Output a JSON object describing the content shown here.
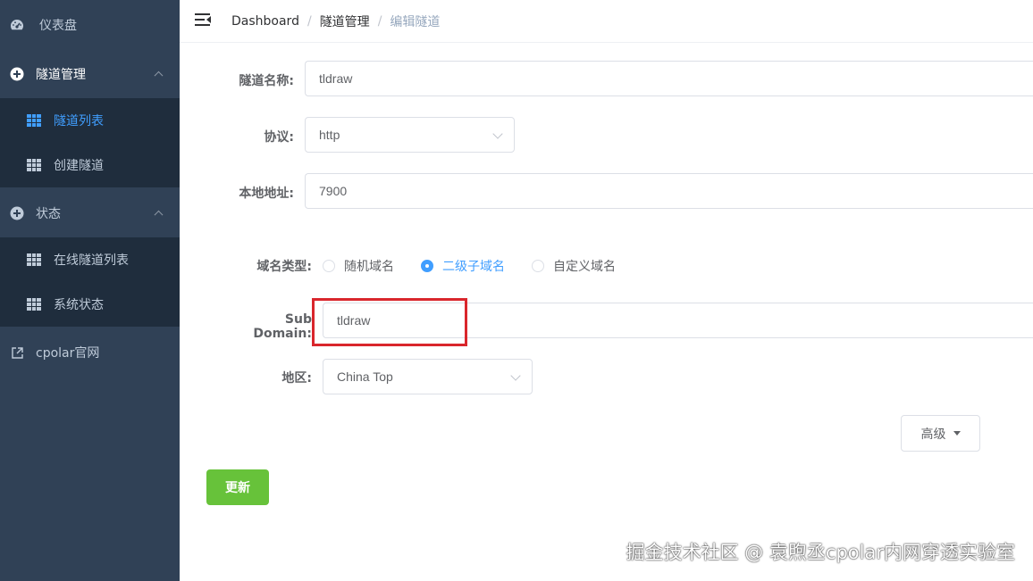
{
  "sidebar": {
    "dashboard": "仪表盘",
    "tunnel_manage": "隧道管理",
    "tunnel_list": "隧道列表",
    "create_tunnel": "创建隧道",
    "status": "状态",
    "online_tunnels": "在线隧道列表",
    "system_status": "系统状态",
    "official_site": "cpolar官网"
  },
  "breadcrumb": {
    "root": "Dashboard",
    "parent": "隧道管理",
    "current": "编辑隧道",
    "separator": "/"
  },
  "form": {
    "name_label": "隧道名称:",
    "name_value": "tldraw",
    "protocol_label": "协议:",
    "protocol_value": "http",
    "local_addr_label": "本地地址:",
    "local_addr_value": "7900",
    "domain_type_label": "域名类型:",
    "domain_types": [
      "随机域名",
      "二级子域名",
      "自定义域名"
    ],
    "domain_type_selected": "二级子域名",
    "subdomain_label": "Sub Domain:",
    "subdomain_value": "tldraw",
    "region_label": "地区:",
    "region_value": "China Top"
  },
  "buttons": {
    "advanced": "高级",
    "update": "更新"
  },
  "watermark": "掘金技术社区 @ 袁煦丞cpolar内网穿透实验室",
  "colors": {
    "sidebar_bg": "#304156",
    "submenu_bg": "#1f2d3d",
    "active": "#409eff",
    "update_button": "#67c23a",
    "highlight_box": "#d9262c"
  }
}
